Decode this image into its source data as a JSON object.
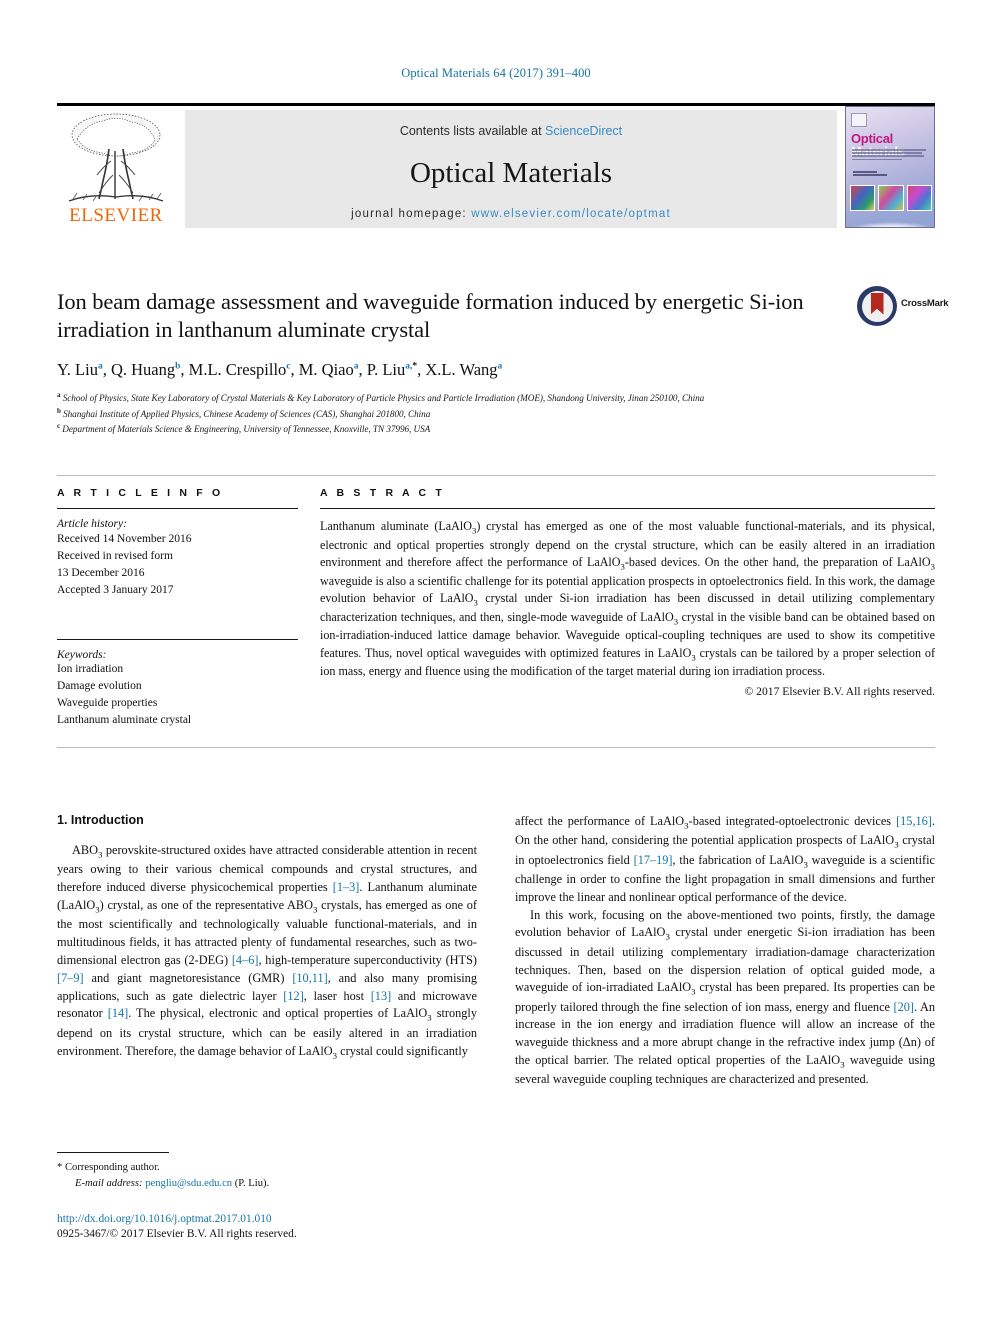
{
  "running_head": "Optical Materials 64 (2017) 391–400",
  "masthead": {
    "publisher": "ELSEVIER",
    "contents_prefix": "Contents lists available at ",
    "contents_link": "ScienceDirect",
    "journal_name": "Optical Materials",
    "homepage_prefix": "journal homepage: ",
    "homepage_url": "www.elsevier.com/locate/optmat",
    "cover": {
      "title_part1": "Optical",
      "title_part2": "Materials",
      "accent_color": "#c2187d"
    },
    "link_color": "#3a8cc4"
  },
  "article": {
    "title": "Ion beam damage assessment and waveguide formation induced by energetic Si-ion irradiation in lanthanum aluminate crystal",
    "crossmark_label": "CrossMark",
    "authors": [
      {
        "name": "Y. Liu",
        "marks": "a"
      },
      {
        "name": "Q. Huang",
        "marks": "b"
      },
      {
        "name": "M.L. Crespillo",
        "marks": "c"
      },
      {
        "name": "M. Qiao",
        "marks": "a"
      },
      {
        "name": "P. Liu",
        "marks": "a, *"
      },
      {
        "name": "X.L. Wang",
        "marks": "a"
      }
    ],
    "affiliations": [
      {
        "mark": "a",
        "text": "School of Physics, State Key Laboratory of Crystal Materials & Key Laboratory of Particle Physics and Particle Irradiation (MOE), Shandong University, Jinan 250100, China"
      },
      {
        "mark": "b",
        "text": "Shanghai Institute of Applied Physics, Chinese Academy of Sciences (CAS), Shanghai 201800, China"
      },
      {
        "mark": "c",
        "text": "Department of Materials Science & Engineering, University of Tennessee, Knoxville, TN 37996, USA"
      }
    ]
  },
  "article_info": {
    "heading": "A R T I C L E  I N F O",
    "history_label": "Article history:",
    "history": [
      "Received 14 November 2016",
      "Received in revised form",
      "13 December 2016",
      "Accepted 3 January 2017"
    ],
    "keywords_label": "Keywords:",
    "keywords": [
      "Ion irradiation",
      "Damage evolution",
      "Waveguide properties",
      "Lanthanum aluminate crystal"
    ]
  },
  "abstract": {
    "heading": "A B S T R A C T",
    "text": "Lanthanum aluminate (LaAlO3) crystal has emerged as one of the most valuable functional-materials, and its physical, electronic and optical properties strongly depend on the crystal structure, which can be easily altered in an irradiation environment and therefore affect the performance of LaAlO3-based devices. On the other hand, the preparation of LaAlO3 waveguide is also a scientific challenge for its potential application prospects in optoelectronics field. In this work, the damage evolution behavior of LaAlO3 crystal under Si-ion irradiation has been discussed in detail utilizing complementary characterization techniques, and then, single-mode waveguide of LaAlO3 crystal in the visible band can be obtained based on ion-irradiation-induced lattice damage behavior. Waveguide optical-coupling techniques are used to show its competitive features. Thus, novel optical waveguides with optimized features in LaAlO3 crystals can be tailored by a proper selection of ion mass, energy and fluence using the modification of the target material during ion irradiation process.",
    "copyright": "© 2017 Elsevier B.V. All rights reserved."
  },
  "introduction": {
    "heading": "1. Introduction",
    "para1": "ABO3 perovskite-structured oxides have attracted considerable attention in recent years owing to their various chemical compounds and crystal structures, and therefore induced diverse physicochemical properties [1–3]. Lanthanum aluminate (LaAlO3) crystal, as one of the representative ABO3 crystals, has emerged as one of the most scientifically and technologically valuable functional-materials, and in multitudinous fields, it has attracted plenty of fundamental researches, such as two-dimensional electron gas (2-DEG) [4–6], high-temperature superconductivity (HTS) [7–9] and giant magnetoresistance (GMR) [10,11], and also many promising applications, such as gate dielectric layer [12], laser host [13] and microwave resonator [14]. The physical, electronic and optical properties of LaAlO3 strongly depend on its crystal structure, which can be easily altered in an irradiation environment. Therefore, the damage behavior of LaAlO3 crystal could significantly affect the performance of LaAlO3-based integrated-optoelectronic devices [15,16]. On the other hand, considering the potential application prospects of LaAlO3 crystal in optoelectronics field [17–19], the fabrication of LaAlO3 waveguide is a scientific challenge in order to confine the light propagation in small dimensions and further improve the linear and nonlinear optical performance of the device.",
    "para2": "In this work, focusing on the above-mentioned two points, firstly, the damage evolution behavior of LaAlO3 crystal under energetic Si-ion irradiation has been discussed in detail utilizing complementary irradiation-damage characterization techniques. Then, based on the dispersion relation of optical guided mode, a waveguide of ion-irradiated LaAlO3 crystal has been prepared. Its properties can be properly tailored through the fine selection of ion mass, energy and fluence [20]. An increase in the ion energy and irradiation fluence will allow an increase of the waveguide thickness and a more abrupt change in the refractive index jump (Δn) of the optical barrier. The related optical properties of the LaAlO3 waveguide using several waveguide coupling techniques are characterized and presented."
  },
  "footer": {
    "corresponding_marker": "*",
    "corresponding_text": "Corresponding author.",
    "email_label": "E-mail address:",
    "email": "pengliu@sdu.edu.cn",
    "email_suffix": "(P. Liu).",
    "doi": "http://dx.doi.org/10.1016/j.optmat.2017.01.010",
    "issn": "0925-3467/© 2017 Elsevier B.V. All rights reserved.",
    "link_color": "#1474a4"
  }
}
